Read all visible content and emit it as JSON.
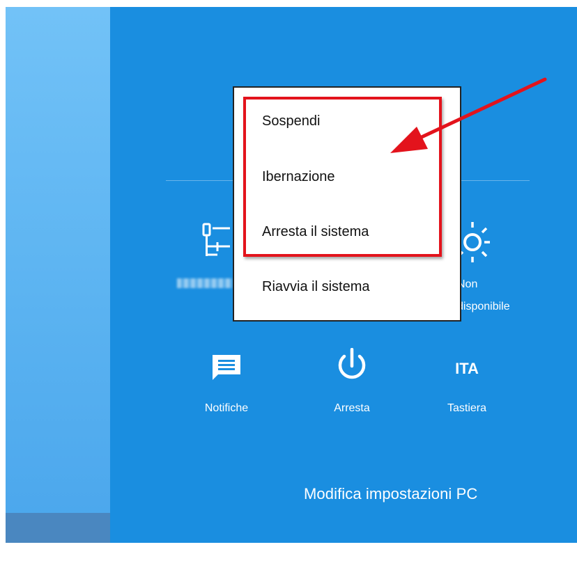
{
  "power_menu": {
    "items": [
      {
        "label": "Sospendi"
      },
      {
        "label": "Ibernazione"
      },
      {
        "label": "Arresta il sistema"
      },
      {
        "label": "Riavvia il sistema"
      }
    ]
  },
  "quick_settings": {
    "network": {
      "icon": "network-icon"
    },
    "brightness": {
      "icon": "brightness-icon",
      "label_line1": "Non",
      "label_line2": "disponibile"
    },
    "notifications": {
      "icon": "notifications-icon",
      "label": "Notifiche"
    },
    "power": {
      "icon": "power-icon",
      "label": "Arresta"
    },
    "keyboard": {
      "icon_text": "ITA",
      "label": "Tastiera"
    }
  },
  "settings_link": "Modifica impostazioni PC",
  "colors": {
    "panel_bg": "#1a8ee0",
    "highlight": "#e3131c",
    "arrow": "#e3131c"
  }
}
